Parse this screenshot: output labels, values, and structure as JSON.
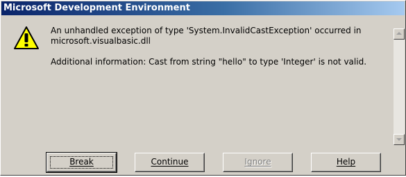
{
  "window": {
    "title": "Microsoft Development Environment"
  },
  "message": {
    "line1": "An unhandled exception of type 'System.InvalidCastException' occurred in",
    "line2": "microsoft.visualbasic.dll",
    "line3": "Additional information: Cast from string \"hello\" to type 'Integer' is not valid."
  },
  "icon": {
    "name": "warning-icon",
    "fill_color": "#ffff00",
    "mark": "!"
  },
  "buttons": {
    "break_label": "Break",
    "continue_label": "Continue",
    "ignore_label": "Ignore",
    "help_label": "Help"
  },
  "colors": {
    "titlebar_start": "#0a246a",
    "titlebar_end": "#a6caf0",
    "dialog_face": "#d4d0c8"
  }
}
